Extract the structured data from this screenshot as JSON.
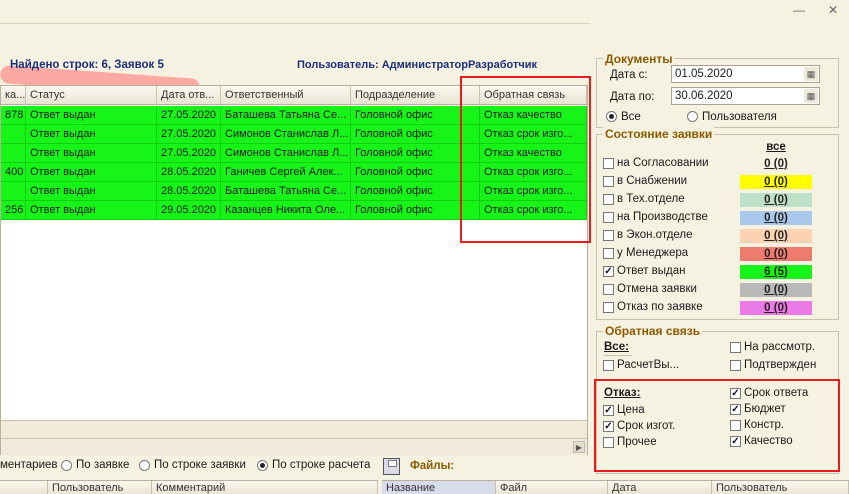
{
  "window": {
    "minimize_glyph": "—",
    "close_glyph": "✕"
  },
  "summary": {
    "found_text": "Найдено строк: 6, Заявок 5",
    "user_text": "Пользователь: АдминистраторРазработчик"
  },
  "table": {
    "columns": [
      "ка...",
      "Статус",
      "Дата отв...",
      "Ответственный",
      "Подразделение",
      "Обратная связь"
    ],
    "rows": [
      [
        "878",
        "Ответ выдан",
        "27.05.2020",
        "Баташева Татьяна Се...",
        "Головной офис",
        "Отказ качество"
      ],
      [
        "",
        "Ответ выдан",
        "27.05.2020",
        "Симонов Станислав Л...",
        "Головной офис",
        "Отказ срок изго..."
      ],
      [
        "",
        "Ответ выдан",
        "27.05.2020",
        "Симонов Станислав Л...",
        "Головной офис",
        "Отказ качество"
      ],
      [
        "400",
        "Ответ выдан",
        "28.05.2020",
        "Ганичев Сергей Алек...",
        "Головной офис",
        "Отказ срок изго..."
      ],
      [
        "",
        "Ответ выдан",
        "28.05.2020",
        "Баташева Татьяна Се...",
        "Головной офис",
        "Отказ срок изго..."
      ],
      [
        "256",
        "Ответ выдан",
        "29.05.2020",
        "Казанцев Никита Оле...",
        "Головной офис",
        "Отказ срок изго..."
      ]
    ],
    "row_color": "#17f417"
  },
  "bottom_bar": {
    "partial_label": "ментариев",
    "options": [
      "По заявке",
      "По строке заявки",
      "По строке расчета"
    ],
    "selected": "По строке расчета",
    "files_label": "Файлы:"
  },
  "comments_grid": {
    "columns": [
      "Пользователь",
      "Комментарий"
    ]
  },
  "files_grid": {
    "columns": [
      "Название",
      "Файл",
      "Дата",
      "Пользователь"
    ]
  },
  "documents": {
    "title": "Документы",
    "date_from_label": "Дата с:",
    "date_from": "01.05.2020",
    "date_to_label": "Дата по:",
    "date_to": "30.06.2020",
    "filter_all": "Все",
    "filter_user": "Пользователя",
    "selected": "Все"
  },
  "request_state": {
    "title": "Состояние заявки",
    "all_label": "все",
    "items": [
      {
        "label": "на Согласовании",
        "count": "0 (0)",
        "checked": false,
        "color": ""
      },
      {
        "label": "в Снабжении",
        "count": "0 (0)",
        "checked": false,
        "color": "#ffff00"
      },
      {
        "label": "в Тех.отделе",
        "count": "0 (0)",
        "checked": false,
        "color": "#bfe0c8"
      },
      {
        "label": "на Производстве",
        "count": "0 (0)",
        "checked": false,
        "color": "#a9c8ea"
      },
      {
        "label": "в Экон.отделе",
        "count": "0 (0)",
        "checked": false,
        "color": "#fbd3b2"
      },
      {
        "label": "у Менеджера",
        "count": "0 (0)",
        "checked": false,
        "color": "#ef7a6e"
      },
      {
        "label": "Ответ выдан",
        "count": "6 (5)",
        "checked": true,
        "color": "#17f417"
      },
      {
        "label": "Отмена заявки",
        "count": "0 (0)",
        "checked": false,
        "color": "#b9b9b9"
      },
      {
        "label": "Отказ по заявке",
        "count": "0 (0)",
        "checked": false,
        "color": "#ea7ae6"
      }
    ]
  },
  "feedback": {
    "title": "Обратная связь",
    "all_label": "Все:",
    "left": [
      {
        "label": "РасчетВы...",
        "checked": false
      }
    ],
    "right": [
      {
        "label": "На рассмотр.",
        "checked": false
      },
      {
        "label": "Подтвержден",
        "checked": false
      }
    ],
    "refusal_label": "Отказ:",
    "refusal_left": [
      {
        "label": "Цена",
        "checked": true
      },
      {
        "label": "Срок изгот.",
        "checked": true
      },
      {
        "label": "Прочее",
        "checked": false
      }
    ],
    "refusal_right": [
      {
        "label": "Срок ответа",
        "checked": true
      },
      {
        "label": "Бюджет",
        "checked": true
      },
      {
        "label": "Констр.",
        "checked": false
      },
      {
        "label": "Качество",
        "checked": true
      }
    ]
  }
}
